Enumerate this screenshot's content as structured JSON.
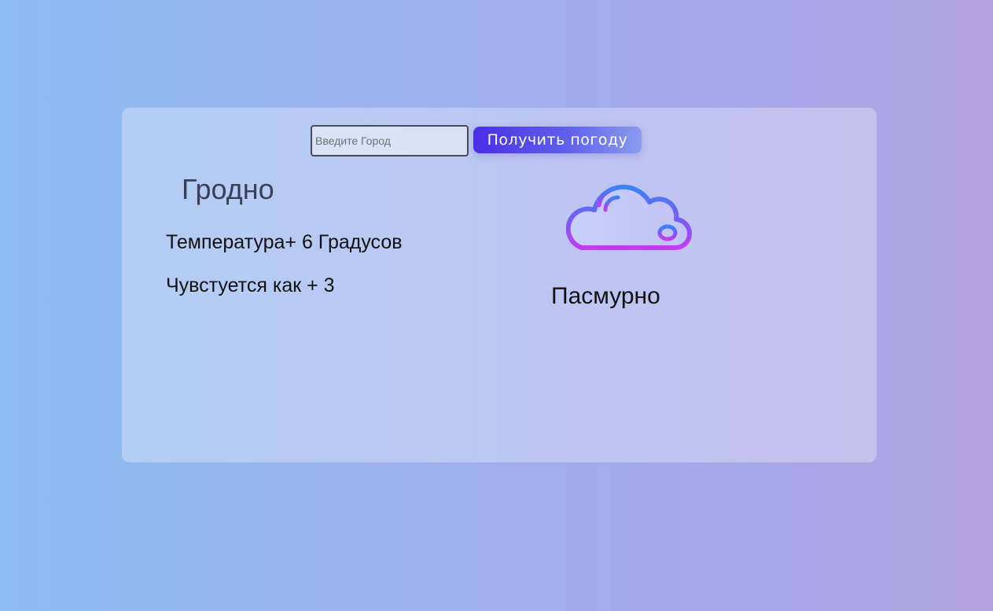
{
  "search": {
    "placeholder": "Введите Город",
    "value": ""
  },
  "actions": {
    "get_weather_label": "Получить погоду"
  },
  "weather": {
    "city": "Гродно",
    "temperature_text": "Температура+ 6 Градусов",
    "feels_like_text": "Чувстуется как + 3",
    "condition": "Пасмурно",
    "icon": "cloud-icon"
  },
  "colors": {
    "button_gradient_start": "#4a2ee6",
    "button_gradient_end": "#8a9cee",
    "icon_gradient_top": "#3b82f6",
    "icon_gradient_bottom": "#c13df0"
  }
}
